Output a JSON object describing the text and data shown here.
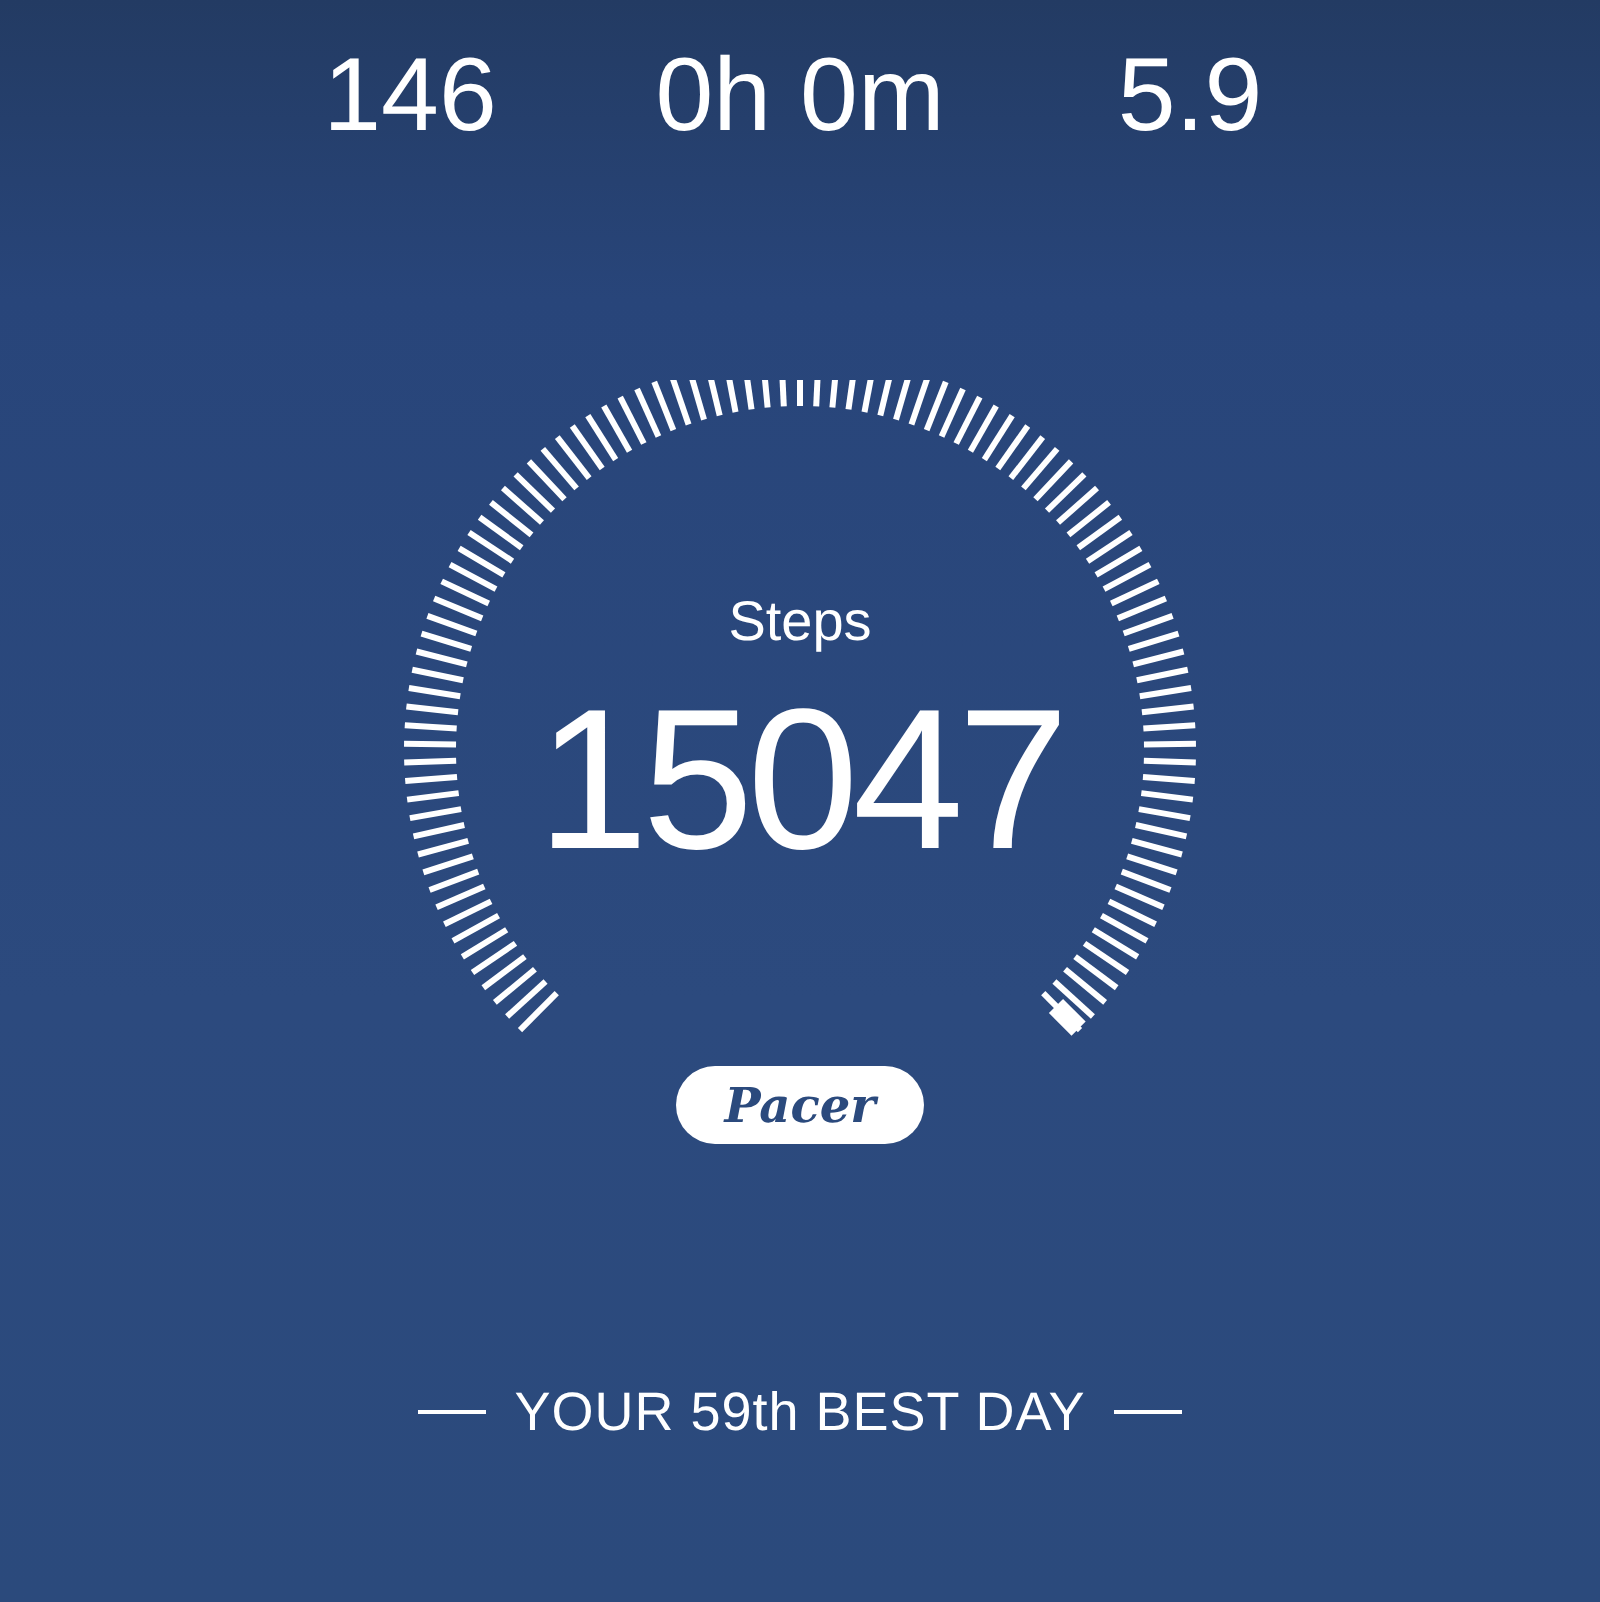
{
  "stats": [
    {
      "value": "146"
    },
    {
      "value": "0h 0m"
    },
    {
      "value": "5.9"
    }
  ],
  "gauge": {
    "label": "Steps",
    "value": "15047"
  },
  "brand": "Pacer",
  "best_day": "YOUR 59th BEST DAY"
}
